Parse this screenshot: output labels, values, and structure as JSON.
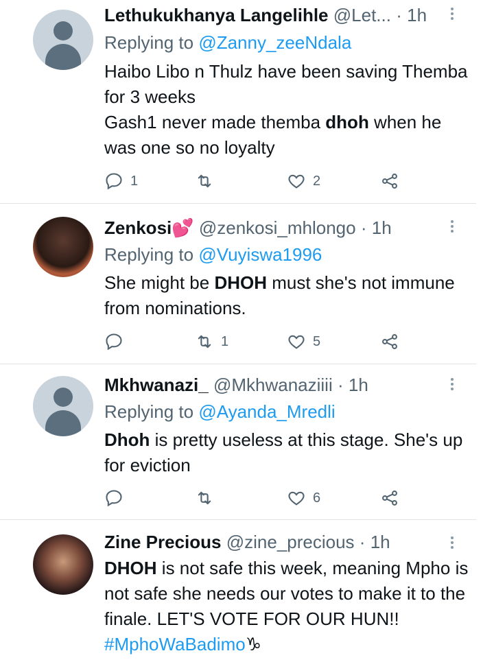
{
  "tweets": [
    {
      "name": "Lethukukhanya Langelihle",
      "handle": "@Let...",
      "dot": "·",
      "time": "1h",
      "reply_prefix": "Replying to",
      "reply_to": "@Zanny_zeeNdala",
      "text_parts": [
        "Haibo Libo n Thulz have been saving Themba for 3 weeks",
        "Gash1 never made themba ",
        "dhoh",
        " when he was one so no loyalty"
      ],
      "replies": "1",
      "retweets": "",
      "likes": "2"
    },
    {
      "name": "Zenkosi",
      "emoji": "💕",
      "handle": "@zenkosi_mhlongo",
      "dot": "·",
      "time": "1h",
      "reply_prefix": "Replying to",
      "reply_to": "@Vuyiswa1996",
      "text_parts": [
        "She might be ",
        "DHOH",
        " must she's not immune from nominations."
      ],
      "replies": "",
      "retweets": "1",
      "likes": "5"
    },
    {
      "name": "Mkhwanazi_",
      "handle": "@Mkhwanaziiii",
      "dot": "·",
      "time": "1h",
      "reply_prefix": "Replying to",
      "reply_to": "@Ayanda_Mredli",
      "text_parts": [
        "Dhoh",
        " is pretty useless at this stage. She's up for eviction"
      ],
      "replies": "",
      "retweets": "",
      "likes": "6"
    },
    {
      "name": "Zine Precious",
      "handle": "@zine_precious",
      "dot": "·",
      "time": "1h",
      "text_parts": [
        "DHOH",
        " is not safe this week, meaning Mpho is not safe she needs our votes to make it to the finale. LET'S VOTE FOR OUR HUN!! ",
        "#MphoWaBadimo",
        "♑"
      ]
    }
  ]
}
